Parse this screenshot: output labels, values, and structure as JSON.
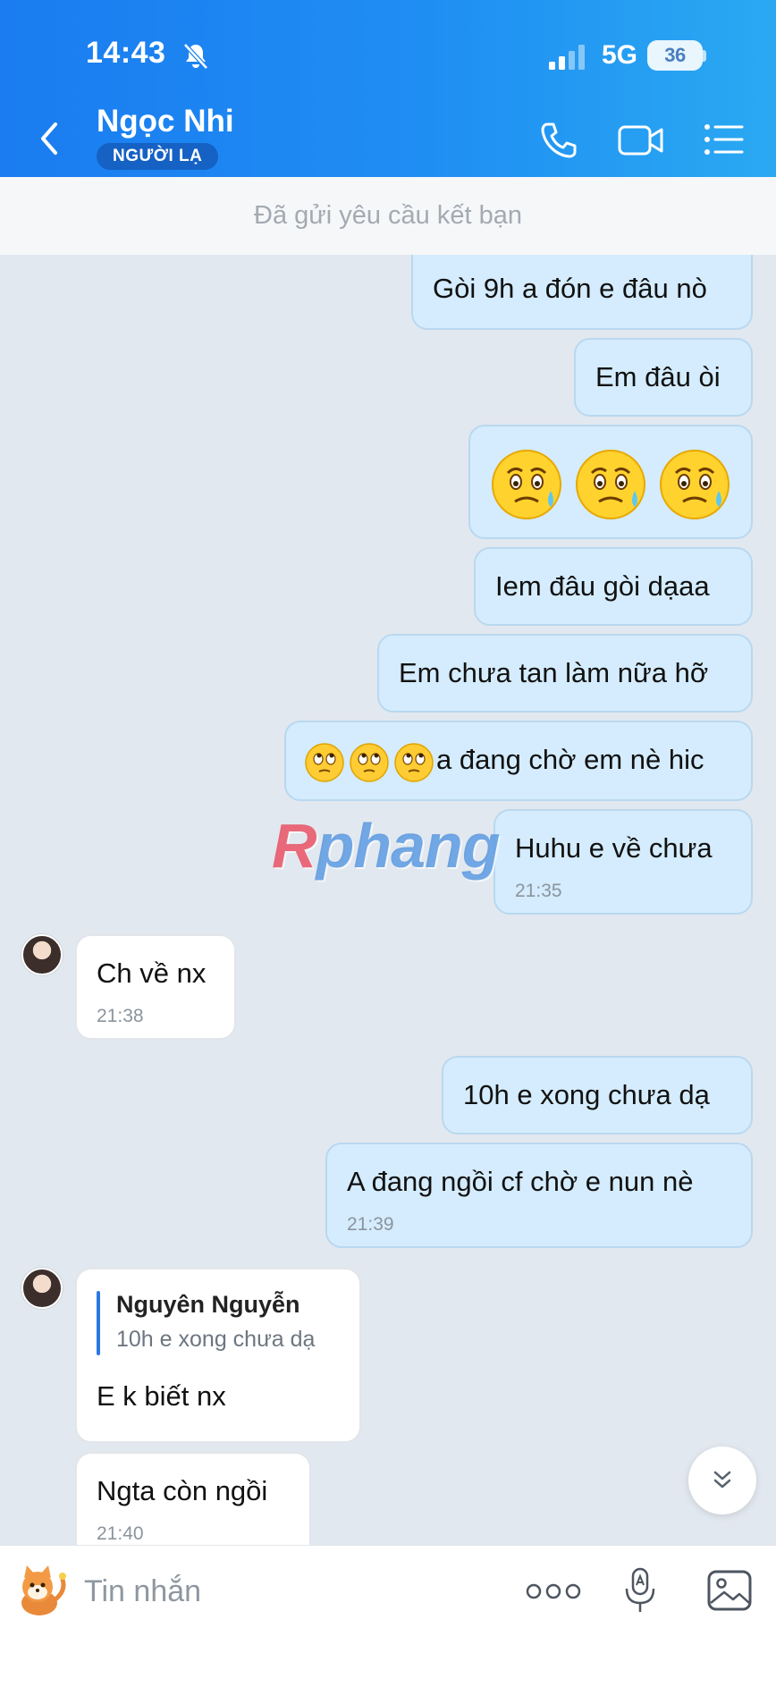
{
  "status_bar": {
    "time": "14:43",
    "network": "5G",
    "battery": "36"
  },
  "header": {
    "contact_name": "Ngọc Nhi",
    "badge": "NGƯỜI LẠ"
  },
  "friend_request_notice": "Đã gửi yêu cầu kết bạn",
  "messages": [
    {
      "direction": "out",
      "text": "Gòi 9h a đón e đâu nò"
    },
    {
      "direction": "out",
      "text": "Em đâu òi"
    },
    {
      "direction": "out",
      "emoji": [
        "sweat-worried",
        "sweat-worried",
        "sweat-worried"
      ]
    },
    {
      "direction": "out",
      "text": "Iem đâu gòi dạaa"
    },
    {
      "direction": "out",
      "text": "Em chưa tan làm nữa hỡ"
    },
    {
      "direction": "out",
      "emoji": [
        "rolling-eyes",
        "rolling-eyes",
        "rolling-eyes"
      ],
      "text": "a đang chờ em nè hic"
    },
    {
      "direction": "out",
      "text": "Huhu e về chưa",
      "time": "21:35"
    },
    {
      "direction": "in",
      "text": "Ch về nx",
      "time": "21:38"
    },
    {
      "direction": "out",
      "text": "10h e xong chưa dạ"
    },
    {
      "direction": "out",
      "text": "A đang ngồi cf chờ e nun nè",
      "time": "21:39"
    },
    {
      "direction": "in",
      "quote": {
        "author": "Nguyên Nguyễn",
        "text": "10h e xong chưa dạ"
      },
      "text": "E k biết nx"
    },
    {
      "direction": "in",
      "text": "Ngta còn ngồi",
      "time": "21:40"
    }
  ],
  "watermark": {
    "first": "R",
    "rest": "phang"
  },
  "composer": {
    "placeholder": "Tin nhắn"
  },
  "colors": {
    "header_gradient_start": "#1a7cf0",
    "header_gradient_end": "#2aa9f2",
    "outgoing_bubble": "#d4ecfd",
    "incoming_bubble": "#ffffff",
    "chat_background": "#e2e8ef",
    "badge_background": "#1561c4"
  },
  "icons": [
    "back-icon",
    "bell-slash-icon",
    "signal-icon",
    "phone-icon",
    "video-icon",
    "menu-list-icon",
    "chevrons-down-icon",
    "sticker-icon",
    "more-icon",
    "voice-icon",
    "image-icon"
  ]
}
